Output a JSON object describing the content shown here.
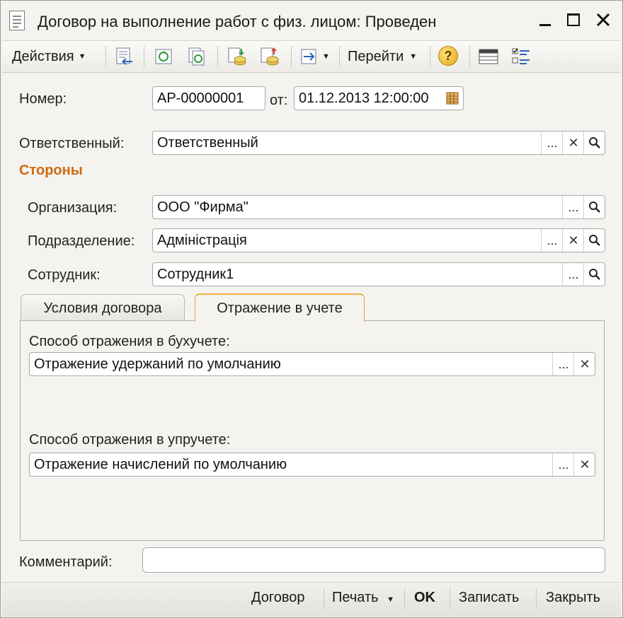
{
  "window": {
    "title": "Договор на выполнение работ с физ. лицом: Проведен",
    "icons": [
      "document-icon",
      "minimize-icon",
      "maximize-icon",
      "close-icon"
    ]
  },
  "toolbar": {
    "actions_label": "Действия",
    "goto_label": "Перейти",
    "help_label": "?"
  },
  "form": {
    "number_label": "Номер:",
    "number_value": "АР-00000001",
    "from_label": "от:",
    "date_value": "01.12.2013 12:00:00",
    "responsible_label": "Ответственный:",
    "responsible_value": "Ответственный",
    "section_label": "Стороны",
    "org_label": "Организация:",
    "org_value": "ООО \"Фирма\"",
    "dept_label": "Подразделение:",
    "dept_value": "Адміністрація",
    "employee_label": "Сотрудник:",
    "employee_value": "Сотрудник1",
    "comment_label": "Комментарий:",
    "comment_value": ""
  },
  "tabs": [
    {
      "label": "Условия договора",
      "active": false
    },
    {
      "label": "Отражение в учете",
      "active": true
    }
  ],
  "panel": {
    "acc_label": "Способ отражения в бухучете:",
    "acc_value": "Отражение удержаний по умолчанию",
    "mgmt_label": "Способ отражения в упручете:",
    "mgmt_value": "Отражение начислений по умолчанию"
  },
  "field_buttons": {
    "select": "...",
    "clear": "✕",
    "search": "🔍"
  },
  "bottom": {
    "contract_label": "Договор",
    "print_label": "Печать",
    "ok_label": "OK",
    "save_label": "Записать",
    "close_label": "Закрыть"
  },
  "colors": {
    "accent_section": "#d06a10",
    "window_bg": "#f4f3ef"
  }
}
